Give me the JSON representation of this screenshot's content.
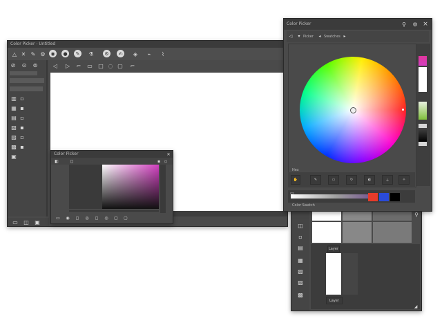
{
  "main_window": {
    "title": "Color Picker - Untitled",
    "toolbar_icons": [
      "triangle-icon",
      "close-icon",
      "pencil-icon",
      "gear-icon",
      "eye-icon",
      "circle-icon",
      "brush-icon",
      "bucket-icon",
      "gear-icon",
      "brush-icon",
      "fill-icon",
      "pin-icon"
    ],
    "sub_toolbar_icons": [
      "arrow-left-icon",
      "arrow-right-icon",
      "bracket-icon",
      "frame-icon",
      "square-icon",
      "circle-icon",
      "square-icon",
      "bracket-icon"
    ],
    "sidebar_tools": [
      "move-icon",
      "lasso-icon",
      "selection-icon",
      "crop-icon",
      "eyedropper-icon",
      "brush-icon",
      "stamp-icon",
      "eraser-icon",
      "gradient-icon",
      "pen-icon",
      "text-icon",
      "shape-icon"
    ],
    "bottom_icons": [
      "layers-icon",
      "mask-icon",
      "folder-icon"
    ]
  },
  "color_panel": {
    "title": "Color Picker",
    "close_label": "×",
    "sub_labels": [
      "Picker",
      "Swatches"
    ],
    "footer_label": "Hex",
    "bottom_label": "Color Swatch",
    "tool_icons": [
      "hand-icon",
      "eyedropper-icon",
      "square-icon",
      "refresh-icon",
      "contrast-icon",
      "plus-icon",
      "star-icon"
    ]
  },
  "small_panel": {
    "title": "Color Picker",
    "bottom_icons": [
      "layers-icon",
      "brush-icon",
      "square-icon",
      "circle-icon",
      "square-icon",
      "circle-icon",
      "square-icon",
      "square-icon"
    ]
  },
  "lower_panel": {
    "tab_label": "Layer",
    "bottom_label": "Layer",
    "side_icons": [
      "close-icon",
      "arrow-icon",
      "layers-icon",
      "text-icon",
      "folder-icon",
      "image-icon",
      "brush-icon"
    ]
  },
  "colors": {
    "panel_bg": "#4a4a4a",
    "dark_bg": "#3a3a3a",
    "accent_magenta": "#d23fc0",
    "accent_red": "#e53b2a",
    "accent_blue": "#2a4bd9"
  }
}
